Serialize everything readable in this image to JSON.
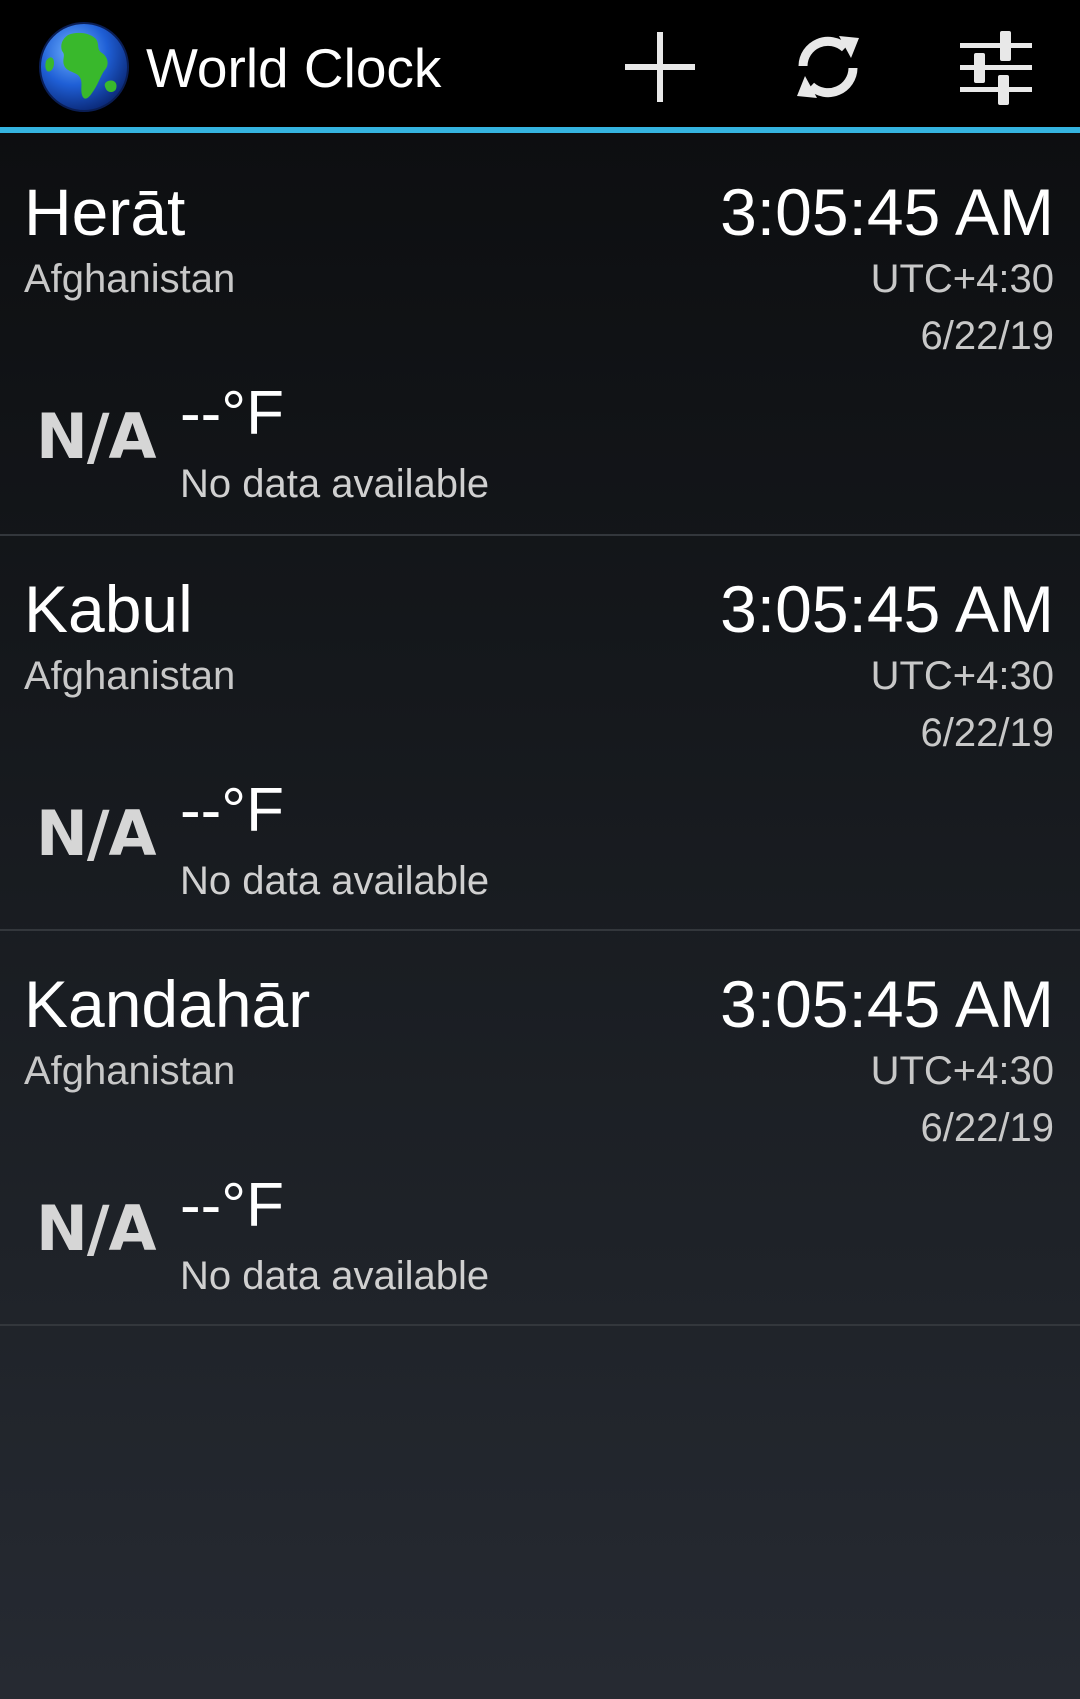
{
  "app": {
    "title": "World Clock",
    "icon": "globe-icon"
  },
  "actions": {
    "add": {
      "icon": "plus-icon"
    },
    "refresh": {
      "icon": "refresh-icon"
    },
    "settings": {
      "icon": "sliders-icon"
    }
  },
  "colors": {
    "accent": "#35b4e0",
    "action_bar": "#000000",
    "divider": "#33373c"
  },
  "cities": [
    {
      "name": "Herāt",
      "country": "Afghanistan",
      "time": "3:05:45 AM",
      "utc": "UTC+4:30",
      "date": "6/22/19",
      "weather_icon": "N/A",
      "temperature": "--°F",
      "condition": "No data available"
    },
    {
      "name": "Kabul",
      "country": "Afghanistan",
      "time": "3:05:45 AM",
      "utc": "UTC+4:30",
      "date": "6/22/19",
      "weather_icon": "N/A",
      "temperature": "--°F",
      "condition": "No data available"
    },
    {
      "name": "Kandahār",
      "country": "Afghanistan",
      "time": "3:05:45 AM",
      "utc": "UTC+4:30",
      "date": "6/22/19",
      "weather_icon": "N/A",
      "temperature": "--°F",
      "condition": "No data available"
    }
  ]
}
